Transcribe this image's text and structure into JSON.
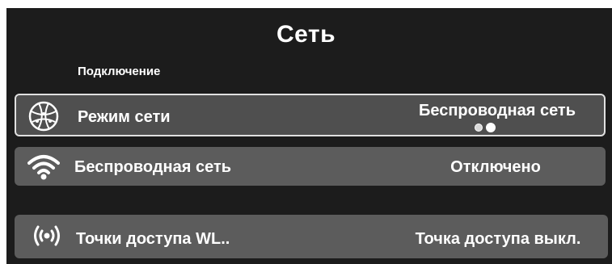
{
  "screen": {
    "title": "Сеть",
    "section_label": "Подключение"
  },
  "rows": [
    {
      "icon": "globe-network-icon",
      "label": "Режим сети",
      "value": "Беспроводная сеть",
      "selected": true,
      "page_indicator": {
        "count": 2,
        "active_index": 1
      }
    },
    {
      "icon": "wifi-icon",
      "label": "Беспроводная сеть",
      "value": "Отключено"
    },
    {
      "icon": "hotspot-icon",
      "label": "Точки доступа WL..",
      "value": "Точка доступа выкл."
    }
  ],
  "colors": {
    "background": "#1c1c1c",
    "row": "#5c5c5c",
    "selected_border": "#e0e0e0",
    "text": "#ffffff"
  }
}
